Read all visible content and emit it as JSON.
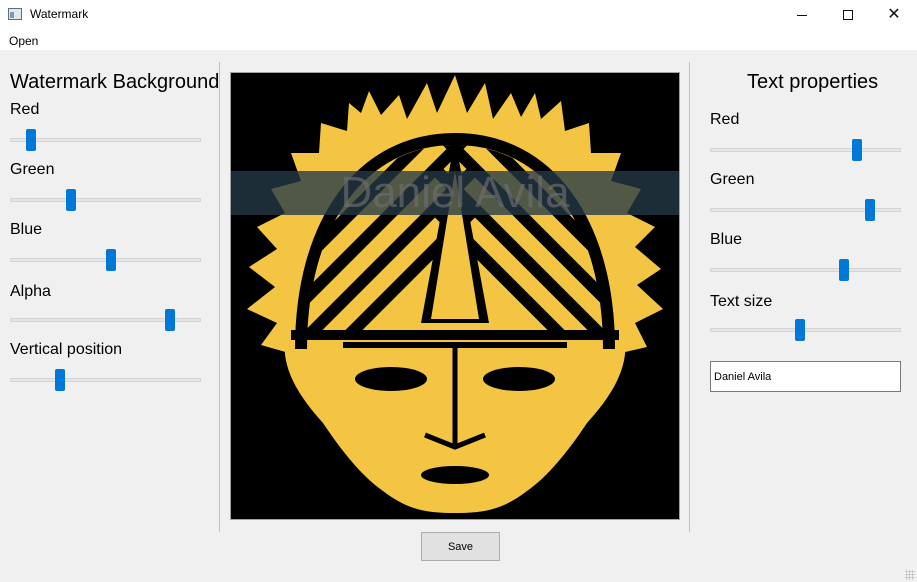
{
  "window": {
    "title": "Watermark",
    "controls": [
      "minimize-icon",
      "maximize-icon",
      "close-icon"
    ]
  },
  "menu": {
    "items": [
      "Open"
    ]
  },
  "left_panel": {
    "heading": "Watermark Background",
    "sliders": [
      {
        "label": "Red",
        "value": 0.11
      },
      {
        "label": "Green",
        "value": 0.32
      },
      {
        "label": "Blue",
        "value": 0.53
      },
      {
        "label": "Alpha",
        "value": 0.84
      },
      {
        "label": "Vertical position",
        "value": 0.26
      }
    ]
  },
  "right_panel": {
    "heading": "Text properties",
    "sliders": [
      {
        "label": "Red",
        "value": 0.77
      },
      {
        "label": "Green",
        "value": 0.84
      },
      {
        "label": "Blue",
        "value": 0.7
      },
      {
        "label": "Text size",
        "value": 0.47
      }
    ],
    "text_value": "Daniel Avila"
  },
  "preview": {
    "watermark_text": "Daniel Avila",
    "colors": {
      "background": "#000000",
      "face": "#f4c542",
      "band": "#243a48",
      "text": "#6e6e6e"
    }
  },
  "save_label": "Save"
}
